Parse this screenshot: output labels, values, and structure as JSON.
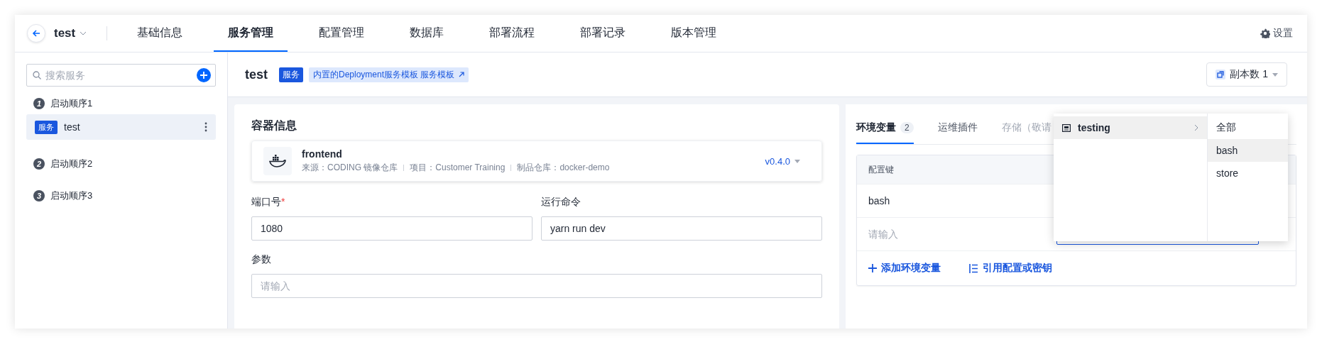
{
  "topbar": {
    "project": "test",
    "nav": [
      {
        "label": "基础信息",
        "selected": false
      },
      {
        "label": "服务管理",
        "selected": true
      },
      {
        "label": "配置管理",
        "selected": false
      },
      {
        "label": "数据库",
        "selected": false
      },
      {
        "label": "部署流程",
        "selected": false
      },
      {
        "label": "部署记录",
        "selected": false
      },
      {
        "label": "版本管理",
        "selected": false
      }
    ],
    "settings": "设置"
  },
  "sidebar": {
    "search_placeholder": "搜索服务",
    "groups": [
      {
        "number": "1",
        "title": "启动顺序1",
        "services": [
          {
            "tag": "服务",
            "name": "test",
            "selected": true
          }
        ]
      },
      {
        "number": "2",
        "title": "启动顺序2"
      },
      {
        "number": "3",
        "title": "启动顺序3"
      }
    ]
  },
  "service_header": {
    "name": "test",
    "tag": "服务",
    "template": "内置的Deployment服务模板 服务模板",
    "replicas": "副本数 1"
  },
  "container": {
    "title": "容器信息",
    "image": {
      "name": "frontend",
      "source": "来源：CODING 镜像仓库",
      "project": "项目：Customer Training",
      "repo": "制品仓库：docker-demo",
      "version": "v0.4.0"
    },
    "fields": [
      {
        "label": "端口号",
        "required_mark": "*",
        "value": "1080"
      },
      {
        "label": "运行命令",
        "value": "yarn run dev"
      },
      {
        "label": "参数",
        "placeholder": "请输入"
      }
    ]
  },
  "env_panel": {
    "tabs": [
      {
        "label": "环境变量",
        "count": "2",
        "selected": true,
        "disabled": false
      },
      {
        "label": "运维插件",
        "selected": false,
        "disabled": false
      },
      {
        "label": "存储（敬请",
        "selected": false,
        "disabled": true
      }
    ],
    "table": {
      "columns": [
        "配置键"
      ],
      "rows": [
        {
          "kind": "text",
          "key": "bash"
        },
        {
          "kind": "input",
          "placeholder": "请输入"
        }
      ]
    },
    "actions": [
      {
        "kind": "add",
        "label": "添加环境变量"
      },
      {
        "kind": "reference",
        "label": "引用配置或密钥"
      }
    ]
  },
  "cascader": {
    "groups": [
      {
        "label": "testing",
        "selected": true
      }
    ],
    "options": [
      {
        "label": "全部",
        "selected": false
      },
      {
        "label": "bash",
        "selected": true
      },
      {
        "label": "store",
        "selected": false
      }
    ]
  }
}
